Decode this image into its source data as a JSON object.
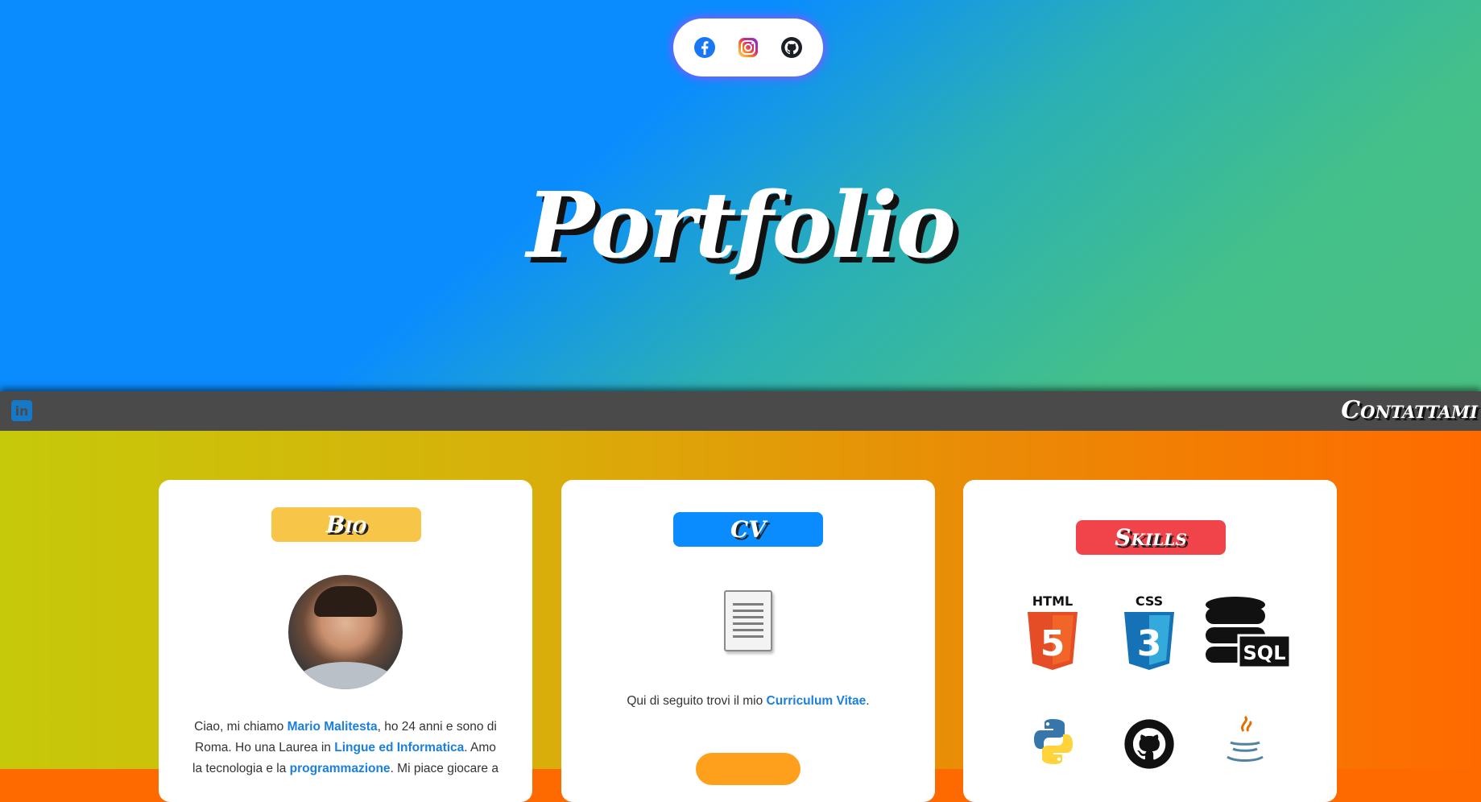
{
  "header": {
    "title": "Portfolio",
    "social_icons": [
      "facebook-icon",
      "instagram-icon",
      "github-icon"
    ]
  },
  "navbar": {
    "linkedin_icon": "linkedin-icon",
    "linkedin_text": "in",
    "contact_label": "Contattami"
  },
  "cards": {
    "bio": {
      "badge": "Bio",
      "badge_color": "#f7c548",
      "text_1": "Ciao, mi chiamo ",
      "name": "Mario Malitesta",
      "text_2": ", ho 24 anni e sono di Roma. Ho una Laurea in ",
      "degree": "Lingue ed Informatica",
      "text_3": ". Amo la tecnologia e la ",
      "passion": "programmazione",
      "text_4": ". Mi piace giocare a"
    },
    "cv": {
      "badge": "CV",
      "badge_color": "#0a8cff",
      "text_1": "Qui di seguito trovi il mio ",
      "link": "Curriculum Vitae",
      "text_2": "."
    },
    "skills": {
      "badge": "Skills",
      "badge_color": "#f0434a",
      "html_label": "HTML",
      "html_num": "5",
      "css_label": "CSS",
      "css_num": "3",
      "sql_label": "SQL",
      "icons": [
        "html5-icon",
        "css3-icon",
        "sql-database-icon",
        "python-icon",
        "github-icon",
        "java-icon"
      ]
    }
  },
  "colors": {
    "hero_gradient": [
      "#0a8cff",
      "#48c083"
    ],
    "content_gradient": [
      "#c6c90a",
      "#ff6a00"
    ],
    "navbar": "#4a4a4a",
    "link": "#1a7fe0"
  }
}
